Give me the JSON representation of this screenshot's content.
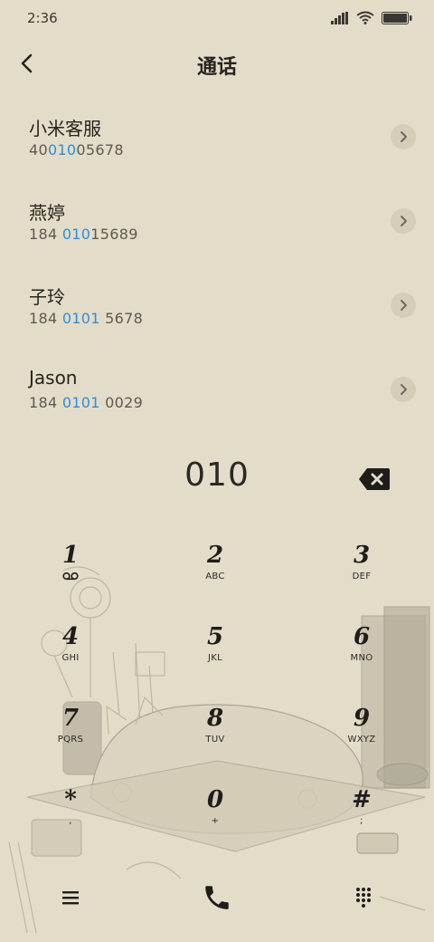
{
  "status_bar": {
    "time": "2:36",
    "icons": [
      "signal-icon",
      "wifi-icon",
      "battery-icon"
    ]
  },
  "header": {
    "back_icon": "chevron-left-icon",
    "title": "通话"
  },
  "results": [
    {
      "name": "小米客服",
      "number_prefix": "40",
      "number_match": "010",
      "number_suffix": "05678"
    },
    {
      "name": "燕婷",
      "number_prefix": "184 ",
      "number_match": "010",
      "number_suffix": "15689"
    },
    {
      "name": "子玲",
      "number_prefix": "184 ",
      "number_match": "0101",
      "number_suffix": " 5678"
    },
    {
      "name": "Jason",
      "number_prefix": "184 ",
      "number_match": "0101",
      "number_suffix": " 0029"
    }
  ],
  "dial": {
    "number": "010",
    "delete_icon": "backspace-icon"
  },
  "keypad": [
    {
      "digit": "1",
      "letters": "",
      "sub_icon": "voicemail-icon"
    },
    {
      "digit": "2",
      "letters": "ABC"
    },
    {
      "digit": "3",
      "letters": "DEF"
    },
    {
      "digit": "4",
      "letters": "GHI"
    },
    {
      "digit": "5",
      "letters": "JKL"
    },
    {
      "digit": "6",
      "letters": "MNO"
    },
    {
      "digit": "7",
      "letters": "PQRS"
    },
    {
      "digit": "8",
      "letters": "TUV"
    },
    {
      "digit": "9",
      "letters": "WXYZ"
    },
    {
      "digit": "*",
      "letters": ","
    },
    {
      "digit": "0",
      "letters": "+"
    },
    {
      "digit": "#",
      "letters": ";"
    }
  ],
  "bottom_bar": {
    "menu_icon": "menu-icon",
    "call_icon": "phone-icon",
    "keypad_icon": "dialpad-icon"
  },
  "colors": {
    "background": "#e3dcc8",
    "highlight": "#2e8fd8",
    "text": "#26241f",
    "secondary_text": "#5d5a52"
  }
}
